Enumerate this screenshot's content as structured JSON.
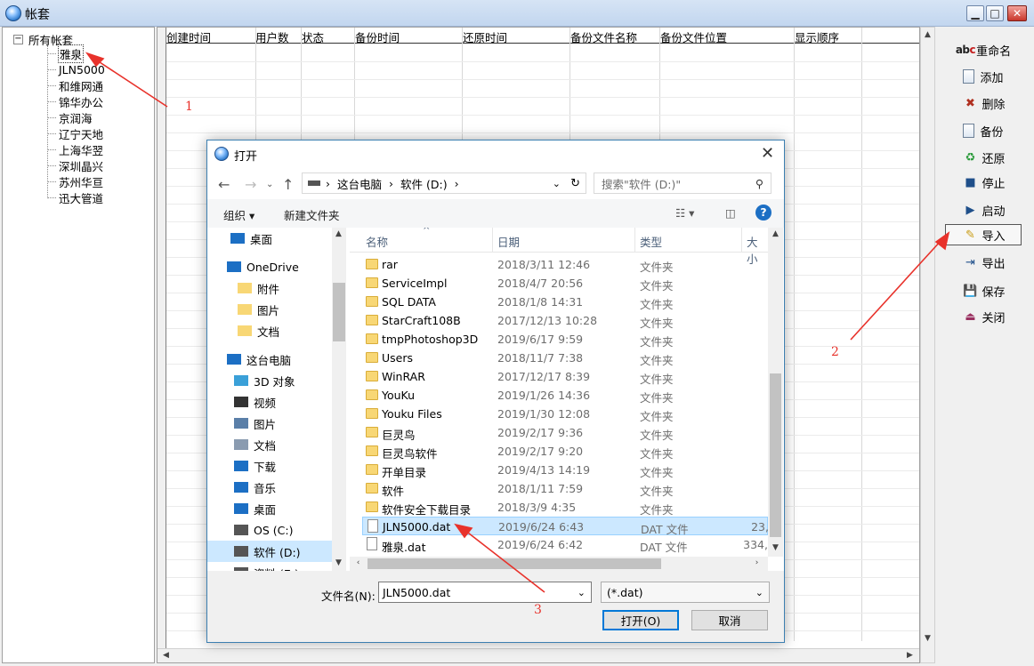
{
  "window": {
    "title": "帐套"
  },
  "tree": {
    "root_label": "所有帐套",
    "toggle": "−",
    "items": [
      "雅泉",
      "JLN5000",
      "和维网通",
      "锦华办公",
      "京润海",
      "辽宁天地",
      "上海华翌",
      "深圳晶兴",
      "苏州华亘",
      "迅大管道"
    ],
    "selected": "雅泉"
  },
  "grid": {
    "columns": [
      "创建时间",
      "用户数",
      "状态",
      "备份时间",
      "还原时间",
      "备份文件名称",
      "备份文件位置",
      "显示顺序"
    ]
  },
  "buttons": {
    "rename": "重命名",
    "add": "添加",
    "delete": "删除",
    "backup": "备份",
    "restore": "还原",
    "stop": "停止",
    "start": "启动",
    "import": "导入",
    "export": "导出",
    "save": "保存",
    "close": "关闭"
  },
  "dialog": {
    "title": "打开",
    "address": {
      "parts": [
        "这台电脑",
        "软件 (D:)"
      ]
    },
    "search_placeholder": "搜索\"软件 (D:)\"",
    "toolbar": {
      "organize": "组织 ▾",
      "new_folder": "新建文件夹"
    },
    "nav_items": [
      {
        "label": "桌面",
        "icon": "desktop-icon"
      },
      {
        "label": "OneDrive",
        "icon": "cloud-icon"
      },
      {
        "label": "附件",
        "icon": "folder-icon"
      },
      {
        "label": "图片",
        "icon": "folder-icon"
      },
      {
        "label": "文档",
        "icon": "folder-icon"
      },
      {
        "label": "这台电脑",
        "icon": "computer-icon"
      },
      {
        "label": "3D 对象",
        "icon": "cube-icon"
      },
      {
        "label": "视频",
        "icon": "video-icon"
      },
      {
        "label": "图片",
        "icon": "pictures-icon"
      },
      {
        "label": "文档",
        "icon": "documents-icon"
      },
      {
        "label": "下载",
        "icon": "download-icon"
      },
      {
        "label": "音乐",
        "icon": "music-icon"
      },
      {
        "label": "桌面",
        "icon": "desktop-icon"
      },
      {
        "label": "OS (C:)",
        "icon": "drive-icon"
      },
      {
        "label": "软件 (D:)",
        "icon": "drive-icon"
      },
      {
        "label": "资料 (E:)",
        "icon": "drive-icon"
      }
    ],
    "nav_selected": "软件 (D:)",
    "columns": {
      "name": "名称",
      "date": "日期",
      "type": "类型",
      "size": "大小"
    },
    "files": [
      {
        "name": "rar",
        "date": "2018/3/11 12:46",
        "type": "文件夹",
        "size": "",
        "kind": "folder"
      },
      {
        "name": "ServiceImpl",
        "date": "2018/4/7 20:56",
        "type": "文件夹",
        "size": "",
        "kind": "folder"
      },
      {
        "name": "SQL DATA",
        "date": "2018/1/8 14:31",
        "type": "文件夹",
        "size": "",
        "kind": "folder"
      },
      {
        "name": "StarCraft108B",
        "date": "2017/12/13 10:28",
        "type": "文件夹",
        "size": "",
        "kind": "folder"
      },
      {
        "name": "tmpPhotoshop3D",
        "date": "2019/6/17 9:59",
        "type": "文件夹",
        "size": "",
        "kind": "folder"
      },
      {
        "name": "Users",
        "date": "2018/11/7 7:38",
        "type": "文件夹",
        "size": "",
        "kind": "folder"
      },
      {
        "name": "WinRAR",
        "date": "2017/12/17 8:39",
        "type": "文件夹",
        "size": "",
        "kind": "folder"
      },
      {
        "name": "YouKu",
        "date": "2019/1/26 14:36",
        "type": "文件夹",
        "size": "",
        "kind": "folder"
      },
      {
        "name": "Youku Files",
        "date": "2019/1/30 12:08",
        "type": "文件夹",
        "size": "",
        "kind": "folder"
      },
      {
        "name": "巨灵鸟",
        "date": "2019/2/17 9:36",
        "type": "文件夹",
        "size": "",
        "kind": "folder"
      },
      {
        "name": "巨灵鸟软件",
        "date": "2019/2/17 9:20",
        "type": "文件夹",
        "size": "",
        "kind": "folder"
      },
      {
        "name": "开单目录",
        "date": "2019/4/13 14:19",
        "type": "文件夹",
        "size": "",
        "kind": "folder"
      },
      {
        "name": "软件",
        "date": "2018/1/11 7:59",
        "type": "文件夹",
        "size": "",
        "kind": "folder"
      },
      {
        "name": "软件安全下载目录",
        "date": "2018/3/9 4:35",
        "type": "文件夹",
        "size": "",
        "kind": "folder"
      },
      {
        "name": "JLN5000.dat",
        "date": "2019/6/24 6:43",
        "type": "DAT 文件",
        "size": "23,",
        "kind": "file"
      },
      {
        "name": "雅泉.dat",
        "date": "2019/6/24 6:42",
        "type": "DAT 文件",
        "size": "334,",
        "kind": "file"
      }
    ],
    "selected_file": "JLN5000.dat",
    "filename_label": "文件名(N):",
    "filename_value": "JLN5000.dat",
    "filetype_value": "(*.dat)",
    "open_label": "打开(O)",
    "cancel_label": "取消"
  },
  "annotations": [
    "1",
    "2",
    "3"
  ],
  "colors": {
    "annotation": "#e8322b",
    "selection": "#cce8ff",
    "accent": "#0078d7"
  }
}
